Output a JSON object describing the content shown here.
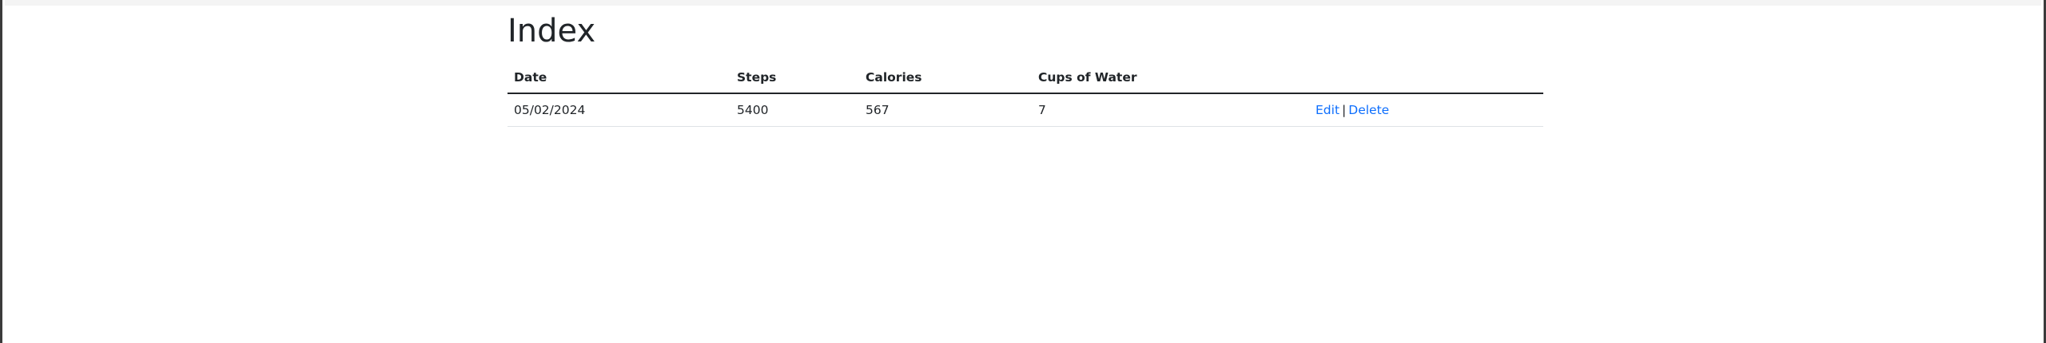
{
  "page": {
    "title": "Index"
  },
  "table": {
    "headers": {
      "date": "Date",
      "steps": "Steps",
      "calories": "Calories",
      "water": "Cups of Water",
      "actions": ""
    },
    "rows": [
      {
        "date": "05/02/2024",
        "steps": "5400",
        "calories": "567",
        "water": "7",
        "edit_label": "Edit",
        "separator": "|",
        "delete_label": "Delete"
      }
    ]
  },
  "colors": {
    "link": "#0d6efd",
    "text": "#212529",
    "header_border": "#212529",
    "row_border": "#dee2e6"
  }
}
